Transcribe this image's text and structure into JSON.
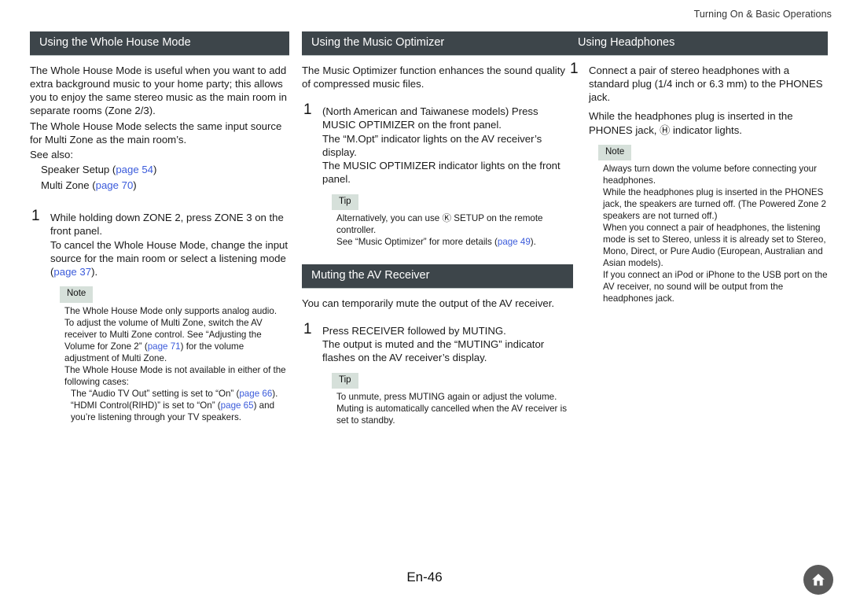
{
  "header": {
    "running_head": "Turning On & Basic Operations"
  },
  "footer": {
    "page_label": "En-46",
    "home_icon": "home-icon"
  },
  "columns": {
    "left": {
      "section_title": "Using the Whole House Mode",
      "intro_1": "The Whole House Mode is useful when you want to add extra background music to your home party; this allows you to enjoy the same stereo music as the main room in separate rooms (Zone 2/3).",
      "intro_2": "The Whole House Mode selects the same input source for Multi Zone as the main room’s.",
      "see_also_label": "See also:",
      "see_also_items": [
        {
          "text": "Speaker Setup (",
          "link": "page 54",
          "tail": ")"
        },
        {
          "text": "Multi Zone (",
          "link": "page 70",
          "tail": ")"
        }
      ],
      "step_1": {
        "number": "1",
        "line_1": "While holding down ZONE 2, press ZONE 3 on the front panel.",
        "line_2_a": "To cancel the Whole House Mode, change the input source for the main room or select a listening mode (",
        "line_2_link": "page 37",
        "line_2_b": ")."
      },
      "note": {
        "label": "Note",
        "items": [
          "The Whole House Mode only supports analog audio.",
          "To adjust the volume of Multi Zone, switch the AV receiver to Multi Zone control. See “Adjusting the Volume for Zone 2” (",
          ") for the volume adjustment of Multi Zone.",
          "The Whole House Mode is not available in either of the following cases:"
        ],
        "link_zone2": "page 71",
        "cases": [
          {
            "a": "The “Audio TV Out” setting is set to “On” (",
            "link": "page 66",
            "b": ")."
          },
          {
            "a": "“HDMI Control(RIHD)” is set to “On” (",
            "link": "page 65",
            "b": ") and you’re listening through your TV speakers."
          }
        ]
      }
    },
    "middle": {
      "section_title_1": "Using the Music Optimizer",
      "intro_1": "The Music Optimizer function enhances the sound quality of compressed music files.",
      "step_1": {
        "number": "1",
        "line_1": "(North American and Taiwanese models) Press MUSIC OPTIMIZER on the front panel.",
        "line_2": "The “M.Opt” indicator lights on the AV receiver’s display.",
        "line_3": "The MUSIC OPTIMIZER indicator lights on the front panel."
      },
      "tip_1": {
        "label": "Tip",
        "line_1": "Alternatively, you can use Ⓚ SETUP on the remote controller.",
        "line_2_a": "See “Music Optimizer” for more details (",
        "line_2_link": "page 49",
        "line_2_b": ")."
      },
      "section_title_2": "Muting the AV Receiver",
      "intro_2": "You can temporarily mute the output of the AV receiver.",
      "step_2": {
        "number": "1",
        "line_1": "Press RECEIVER followed by MUTING.",
        "line_2": "The output is muted and the “MUTING” indicator flashes on the AV receiver’s display."
      },
      "tip_2": {
        "label": "Tip",
        "items": [
          "To unmute, press MUTING again or adjust the volume.",
          "Muting is automatically cancelled when the AV receiver is set to standby."
        ]
      }
    },
    "right": {
      "section_title": "Using Headphones",
      "step_1": {
        "number": "1",
        "line_1": "Connect a pair of stereo headphones with a standard plug (1/4 inch or 6.3 mm) to the PHONES jack.",
        "line_2": "While the headphones plug is inserted in the PHONES jack, Ⓗ indicator lights."
      },
      "note": {
        "label": "Note",
        "items": [
          "Always turn down the volume before connecting your headphones.",
          "While the headphones plug is inserted in the PHONES jack, the speakers are turned off. (The Powered Zone 2 speakers are not turned off.)",
          "When you connect a pair of headphones, the listening mode is set to Stereo, unless it is already set to Stereo, Mono, Direct, or Pure Audio (European, Australian and Asian models).",
          "If you connect an iPod or iPhone to the USB port on the AV receiver, no sound will be output from the headphones jack."
        ]
      }
    }
  }
}
